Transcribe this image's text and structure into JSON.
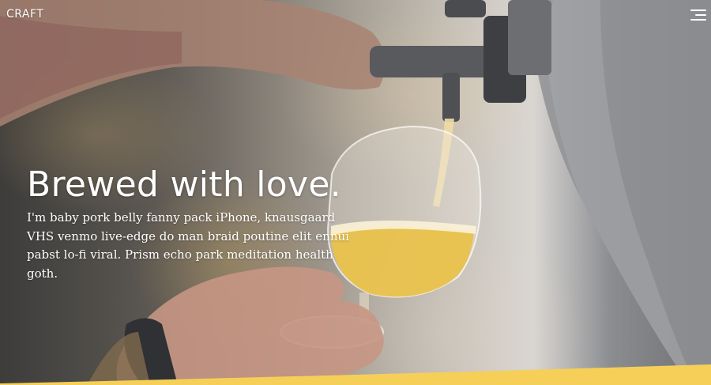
{
  "nav": {
    "brand": "CRAFT",
    "menu_icon": "hamburger-menu-icon"
  },
  "hero": {
    "headline": "Brewed with love.",
    "lead": "I'm baby pork belly fanny pack iPhone, knausgaard VHS venmo live-edge do man braid poutine elit ennui pabst lo-fi viral. Prism echo park meditation health goth.",
    "image_subject": "beer being poured from a tap into a tulip glass"
  },
  "colors": {
    "text": "#ffffff",
    "accent": "#f6cf58",
    "beer": "#e9c24c"
  }
}
